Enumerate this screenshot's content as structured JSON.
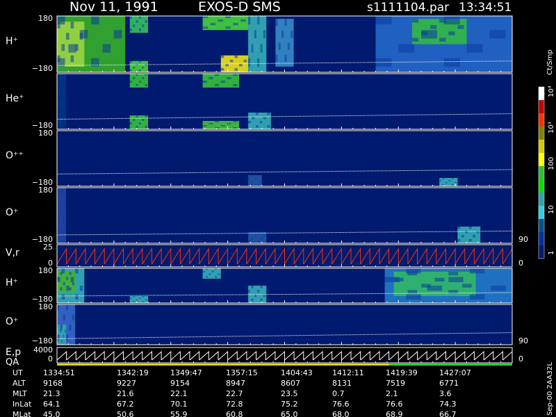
{
  "header": {
    "date": "Nov 11, 1991",
    "instrument": "EXOS-D SMS",
    "file": "s1111104.par",
    "time": "13:34:51"
  },
  "colorbar": {
    "unit": "Ct/Smp",
    "labels": [
      "10⁴",
      "10³",
      "100",
      "10",
      "1"
    ],
    "colors": [
      "#ffffff",
      "#c80000",
      "#ff3000",
      "#808000",
      "#d8c800",
      "#ffff00",
      "#30c030",
      "#00e000",
      "#30a0b0",
      "#30d0e0",
      "#005090",
      "#0030a0",
      "#001a70"
    ]
  },
  "footer_tag": "Sep-00 2AA32L",
  "chart_data": {
    "type": "heatmap",
    "panels": [
      {
        "label": "H⁺",
        "ymax": "180",
        "ymin": "−180",
        "kind": "spectrogram",
        "blocks": [
          [
            0.0,
            0.15,
            0,
            1,
            "#30a030"
          ],
          [
            0.0,
            0.06,
            0.1,
            0.9,
            "#90d040"
          ],
          [
            0.16,
            0.2,
            0,
            0.3,
            "#30b060"
          ],
          [
            0.16,
            0.2,
            0.8,
            1,
            "#40c040"
          ],
          [
            0.32,
            0.42,
            0,
            0.25,
            "#40c040"
          ],
          [
            0.36,
            0.42,
            0.7,
            1,
            "#d8d020"
          ],
          [
            0.42,
            0.46,
            0,
            1,
            "#30a0b0"
          ],
          [
            0.48,
            0.52,
            0.05,
            0.9,
            "#3080c0"
          ],
          [
            0.7,
            1,
            0.0,
            1,
            "#2060c0"
          ],
          [
            0.78,
            0.9,
            0.05,
            0.5,
            "#30b050"
          ]
        ],
        "trace": [
          0.88,
          0.8
        ]
      },
      {
        "label": "He⁺",
        "ymax": "",
        "ymin": "−180",
        "kind": "spectrogram",
        "blocks": [
          [
            0.16,
            0.2,
            0,
            0.25,
            "#30b040"
          ],
          [
            0.16,
            0.2,
            0.75,
            1,
            "#30b040"
          ],
          [
            0.32,
            0.4,
            0,
            0.25,
            "#30b040"
          ],
          [
            0.32,
            0.4,
            0.85,
            1,
            "#40b040"
          ],
          [
            0.42,
            0.47,
            0.7,
            1,
            "#30a0b0"
          ],
          [
            0.0,
            0.02,
            0,
            1,
            "#003080"
          ]
        ],
        "trace": [
          0.82,
          0.72
        ]
      },
      {
        "label": "O⁺⁺",
        "ymax": "180",
        "ymin": "−180",
        "kind": "spectrogram",
        "blocks": [
          [
            0.42,
            0.45,
            0.8,
            1,
            "#2050a0"
          ],
          [
            0.84,
            0.88,
            0.85,
            1,
            "#30a0b0"
          ]
        ],
        "trace": [
          0.78,
          0.7
        ]
      },
      {
        "label": "O⁺",
        "ymax": "180",
        "ymin": "−180",
        "kind": "spectrogram",
        "blocks": [
          [
            0.0,
            0.02,
            0,
            1,
            "#2040a0"
          ],
          [
            0.42,
            0.46,
            0.8,
            1,
            "#2050a0"
          ],
          [
            0.88,
            0.93,
            0.7,
            1,
            "#30a0b0"
          ]
        ],
        "trace": [
          0.85,
          0.78
        ],
        "right_label": "90"
      },
      {
        "label": "V,r",
        "ymax": "25",
        "ymin": "0",
        "kind": "sawtooth",
        "color": "#ff3000",
        "right_label": "0"
      },
      {
        "label": "H⁺",
        "ymax": "180",
        "ymin": "−180",
        "kind": "spectrogram",
        "blocks": [
          [
            0.0,
            0.06,
            0,
            1,
            "#30a0b0"
          ],
          [
            0.0,
            0.04,
            0.1,
            0.7,
            "#40b040"
          ],
          [
            0.16,
            0.2,
            0.8,
            1,
            "#30a0b0"
          ],
          [
            0.32,
            0.36,
            0,
            0.3,
            "#30a0b0"
          ],
          [
            0.42,
            0.46,
            0.5,
            1,
            "#30a0b0"
          ],
          [
            0.72,
            1,
            0,
            1,
            "#2070c0"
          ],
          [
            0.74,
            0.92,
            0.1,
            0.8,
            "#30b070"
          ]
        ],
        "trace": [
          0.8,
          0.7
        ]
      },
      {
        "label": "O⁺",
        "ymax": "180",
        "ymin": "−180",
        "kind": "spectrogram",
        "blocks": [
          [
            0.0,
            0.04,
            0,
            1,
            "#3060c0"
          ],
          [
            0.0,
            0.02,
            0.5,
            1,
            "#30a0b0"
          ]
        ],
        "trace": [
          0.85,
          0.7
        ],
        "right_label": "90"
      },
      {
        "label": "E,p",
        "sublabel": "QA",
        "ymax": "4000",
        "ymin": "0",
        "kind": "sawtooth",
        "color": "#ffffff",
        "right_label": "0",
        "qa": [
          [
            0.0,
            0.73,
            "#d8d020"
          ],
          [
            0.73,
            1.0,
            "#30d040"
          ]
        ]
      }
    ],
    "ephemeris": {
      "rows": [
        {
          "name": "UT",
          "values": [
            "1334:51",
            "1342:19",
            "1349:47",
            "1357:15",
            "1404:43",
            "1412:11",
            "1419:39",
            "1427:07"
          ]
        },
        {
          "name": "ALT",
          "values": [
            "9168",
            "9227",
            "9154",
            "8947",
            "8607",
            "8131",
            "7519",
            "6771"
          ]
        },
        {
          "name": "MLT",
          "values": [
            "21.3",
            "21.6",
            "22.1",
            "22.7",
            "23.5",
            "0.7",
            "2.1",
            "3.6"
          ]
        },
        {
          "name": "InLat",
          "values": [
            "64.1",
            "67.2",
            "70.1",
            "72.8",
            "75.2",
            "76.6",
            "76.6",
            "74.3"
          ]
        },
        {
          "name": "MLat",
          "values": [
            "45.0",
            "50.6",
            "55.9",
            "60.8",
            "65.0",
            "68.0",
            "68.9",
            "66.7"
          ]
        }
      ]
    }
  }
}
